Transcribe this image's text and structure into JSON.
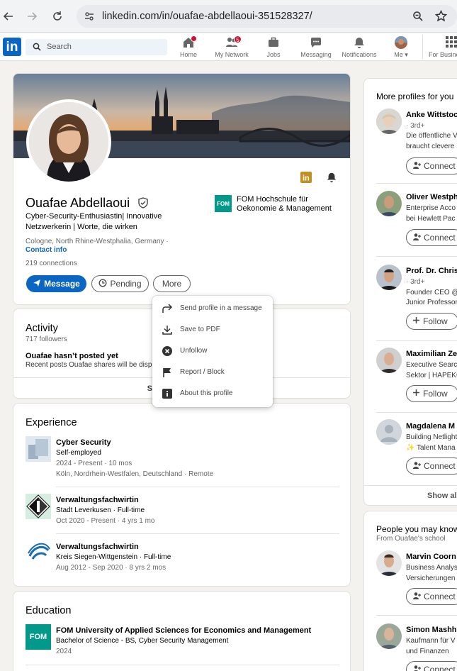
{
  "browser": {
    "url": "linkedin.com/in/ouafae-abdellaoui-351528327/"
  },
  "nav": {
    "logo": "in",
    "search_placeholder": "Search",
    "items": [
      {
        "label": "Home",
        "badge": ""
      },
      {
        "label": "My Network",
        "badge": "5"
      },
      {
        "label": "Jobs",
        "badge": ""
      },
      {
        "label": "Messaging",
        "badge": ""
      },
      {
        "label": "Notifications",
        "badge": ""
      },
      {
        "label": "Me ▾",
        "badge": ""
      },
      {
        "label": "For Business",
        "badge": ""
      }
    ]
  },
  "profile": {
    "name": "Ouafae Abdellaoui",
    "headline_line1": "Cyber-Security-Enthusiastin| Innovative",
    "headline_line2": "Netzwerkerin | Worte, die wirken",
    "location": "Cologne, North Rhine-Westphalia, Germany ·",
    "contact_info": "Contact info",
    "connections": "219 connections",
    "school_line1": "FOM Hochschule für",
    "school_line2": "Oekonomie & Management",
    "school_logo": "FOM",
    "buttons": {
      "message": "Message",
      "pending": "Pending",
      "more": "More"
    }
  },
  "dropdown": {
    "items": [
      {
        "label": "Send profile in a message",
        "icon": "share-arrow-icon"
      },
      {
        "label": "Save to PDF",
        "icon": "download-icon"
      },
      {
        "label": "Unfollow",
        "icon": "close-circle-icon"
      },
      {
        "label": "Report / Block",
        "icon": "flag-icon"
      },
      {
        "label": "About this profile",
        "icon": "info-icon"
      }
    ]
  },
  "activity": {
    "title": "Activity",
    "followers": "717 followers",
    "no_posts": "Ouafae hasn’t posted yet",
    "sub": "Recent posts Ouafae shares will be displayed here.",
    "show_all": "Show all activity →"
  },
  "experience": {
    "title": "Experience",
    "items": [
      {
        "title": "Cyber Security",
        "company": "Self-employed",
        "dates": "2024 - Present · 10 mos",
        "location": "Köln, Nordrhein-Westfalen, Deutschland · Remote"
      },
      {
        "title": "Verwaltungsfachwirtin",
        "company": "Stadt Leverkusen · Full-time",
        "dates": "Oct 2020 - Present · 4 yrs 1 mo",
        "location": ""
      },
      {
        "title": "Verwaltungsfachwirtin",
        "company": "Kreis Siegen-Wittgenstein · Full-time",
        "dates": "Aug 2012 - Sep 2020 · 8 yrs 2 mos",
        "location": ""
      }
    ]
  },
  "education": {
    "title": "Education",
    "items": [
      {
        "school": "FOM University of Applied Sciences for Economics and Management",
        "degree": "Bachelor of Science - BS, Cyber Security Management",
        "dates": "2024",
        "logo": "FOM"
      }
    ]
  },
  "more_profiles": {
    "title": "More profiles for you",
    "show_all": "Show all",
    "items": [
      {
        "name": "Anke Wittstock",
        "degree": "· 3rd+",
        "line1": "Die öffentliche V",
        "line2": "braucht clevere",
        "action": "Connect"
      },
      {
        "name": "Oliver Westphal",
        "degree": "",
        "line1": "Enterprise Acco",
        "line2": "bei Hewlett Pac",
        "action": "Connect"
      },
      {
        "name": "Prof. Dr. Christ",
        "degree": "· 3rd+",
        "line1": "Founder CEO @",
        "line2": "Junior Professor",
        "action": "Follow"
      },
      {
        "name": "Maximilian Ze",
        "degree": "",
        "line1": "Executive Search",
        "line2": "Sektor | HAPEKO",
        "action": "Follow"
      },
      {
        "name": "Magdalena M",
        "degree": "",
        "line1": "Building Netlight",
        "line2": "✨ Talent Mana",
        "action": "Connect"
      }
    ]
  },
  "people_you_may_know": {
    "title": "People you may know",
    "subtitle": "From Ouafae's school",
    "items": [
      {
        "name": "Marvin Coorn",
        "line1": "Business Analyst",
        "line2": "Versicherungen",
        "action": "Connect"
      },
      {
        "name": "Simon Mashh",
        "line1": "Kaufmann für V",
        "line2": "und Finanzen",
        "action": "Connect"
      }
    ]
  },
  "colors": {
    "primary": "#0a66c2",
    "badge": "#cb112d",
    "fom_teal": "#00998a",
    "linkedin_gold": "#c38f22"
  }
}
